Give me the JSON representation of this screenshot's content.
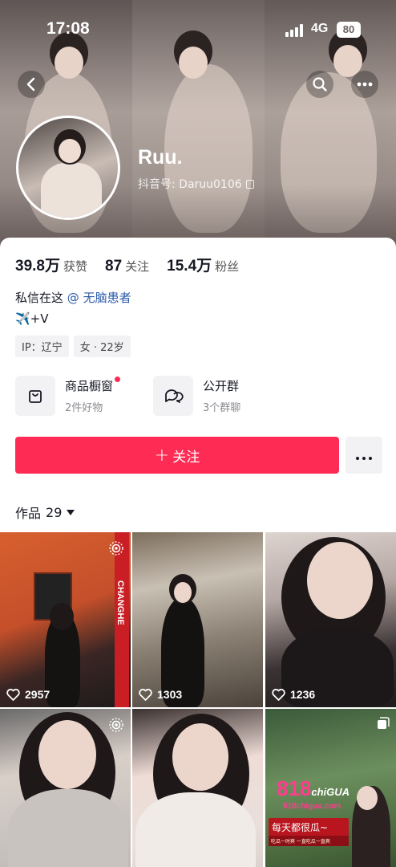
{
  "status_bar": {
    "time": "17:08",
    "network": "4G",
    "battery": "80"
  },
  "header": {
    "nickname": "Ruu.",
    "account_label": "抖音号: Daruu0106",
    "icons": [
      "back-arrow-icon",
      "search-icon",
      "more-dots-icon",
      "copy-icon"
    ]
  },
  "stats": {
    "likes_value": "39.8万",
    "likes_label": "获赞",
    "following_value": "87",
    "following_label": "关注",
    "followers_value": "15.4万",
    "followers_label": "粉丝"
  },
  "bio": {
    "line1_text": "私信在这",
    "mention": "@ 无脑患者",
    "line2_text": "✈️+V"
  },
  "tags": [
    "IP：辽宁",
    "女 · 22岁"
  ],
  "features": {
    "shop_title": "商品橱窗",
    "shop_sub": "2件好物",
    "group_title": "公开群",
    "group_sub": "3个群聊"
  },
  "actions": {
    "follow_label": "关注",
    "follow_color": "#fe2c55"
  },
  "works": {
    "tab_label": "作品",
    "count": "29"
  },
  "grid": {
    "tiles": [
      {
        "likes": "2957",
        "badge": "live-photo-icon",
        "stripe_text": "CHANGHE"
      },
      {
        "likes": "1303"
      },
      {
        "likes": "1236"
      },
      {
        "likes": "",
        "badge": "live-photo-icon"
      },
      {
        "likes": ""
      },
      {
        "likes": "",
        "badge": "multi-image-icon"
      }
    ],
    "promo": {
      "logo_number": "818",
      "logo_word": "chiGUA",
      "url": "818chigua.com",
      "slogan": "每天都很瓜~",
      "sub": "吃瓜一时爽 一直吃瓜一直爽"
    }
  }
}
